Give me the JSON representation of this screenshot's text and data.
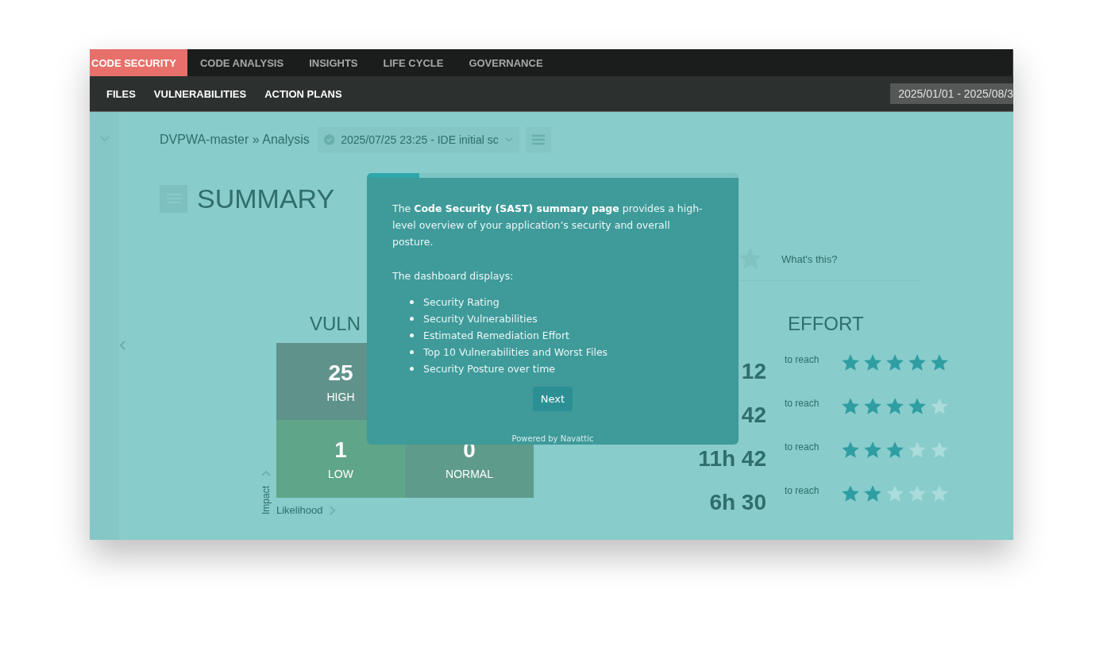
{
  "top_tabs": [
    {
      "label": "CODE SECURITY",
      "selected": true
    },
    {
      "label": "CODE ANALYSIS",
      "selected": false
    },
    {
      "label": "INSIGHTS",
      "selected": false
    },
    {
      "label": "LIFE CYCLE",
      "selected": false
    },
    {
      "label": "GOVERNANCE",
      "selected": false
    }
  ],
  "sub_tabs": [
    "FILES",
    "VULNERABILITIES",
    "ACTION PLANS"
  ],
  "date_range": "2025/01/01 - 2025/08/3",
  "breadcrumb": "DVPWA-master » Analysis",
  "analysis_select": "2025/07/25 23:25 - IDE initial sc",
  "page_title": "SUMMARY",
  "rating": {
    "link": "What's this?"
  },
  "vulnerabilities": {
    "title": "VULN",
    "cells": [
      {
        "count": "25",
        "label": "HIGH",
        "color": "#5f928b"
      },
      {
        "count": "1",
        "label": "LOW",
        "color": "#5fa589"
      },
      {
        "count": "0",
        "label": "NORMAL",
        "color": "#5f9b8b"
      }
    ],
    "y_axis": "Impact",
    "x_axis": "Likelihood"
  },
  "effort": {
    "title": "EFFORT",
    "rows": [
      {
        "value": "12",
        "caption": "to reach",
        "stars": 5
      },
      {
        "value": "42",
        "caption": "to reach",
        "stars": 4
      },
      {
        "value": "11h 42",
        "caption": "to reach",
        "stars": 3
      },
      {
        "value": "6h 30",
        "caption": "to reach",
        "stars": 2
      }
    ]
  },
  "tour": {
    "text": "The **Code Security (SAST) summary page** provides a high-level overview of your application’s security and overall posture.",
    "list_title": "The dashboard displays:",
    "items": [
      "Security Rating",
      "Security Vulnerabilities",
      "Estimated Remediation Effort",
      "Top 10 Vulnerabilities and Worst Files",
      "Security Posture over time"
    ],
    "button": "Next",
    "footer": "Powered by Navattic",
    "level": 0.14
  }
}
